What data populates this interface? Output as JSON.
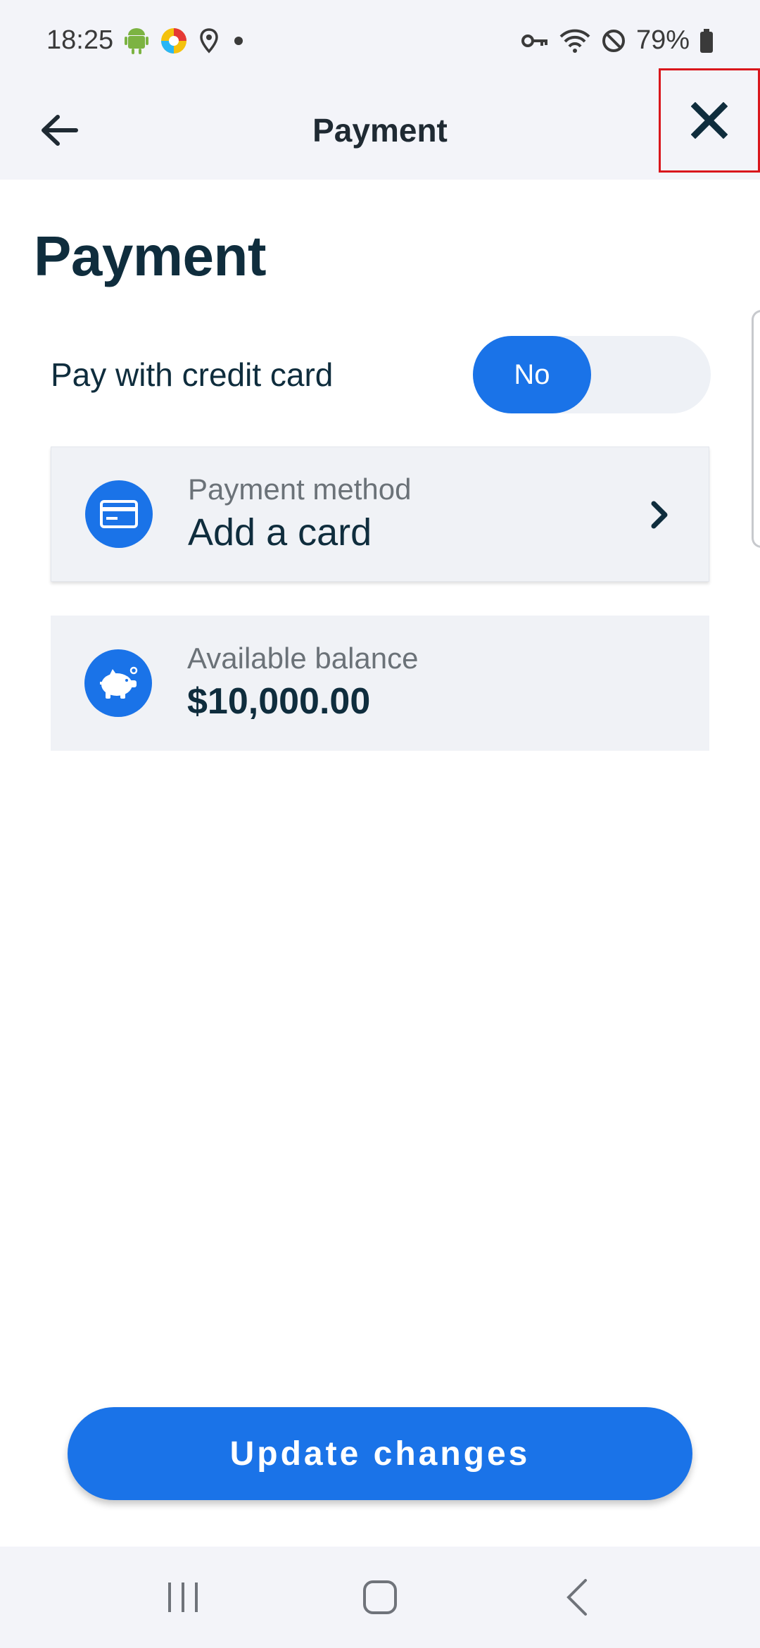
{
  "status_bar": {
    "time": "18:25",
    "battery": "79%",
    "icons": [
      "android-icon",
      "colorful-app-icon",
      "location-icon",
      "dot-icon",
      "vpn-key-icon",
      "wifi-icon",
      "do-not-disturb-icon",
      "battery-icon"
    ]
  },
  "app_bar": {
    "title": "Payment",
    "back_icon": "arrow-left-icon",
    "close_icon": "close-icon"
  },
  "page": {
    "heading": "Payment",
    "toggle": {
      "label": "Pay with credit card",
      "value": "No"
    },
    "payment_method": {
      "caption": "Payment method",
      "value": "Add a card",
      "icon": "credit-card-icon"
    },
    "balance": {
      "caption": "Available balance",
      "value": "$10,000.00",
      "icon": "piggy-bank-icon"
    }
  },
  "actions": {
    "update_label": "Update changes"
  },
  "colors": {
    "accent": "#1a73e8",
    "text_dark": "#0f2d3d",
    "bar_bg": "#f3f4f9",
    "card_bg": "#f0f2f6",
    "highlight_border": "#d9161c"
  }
}
